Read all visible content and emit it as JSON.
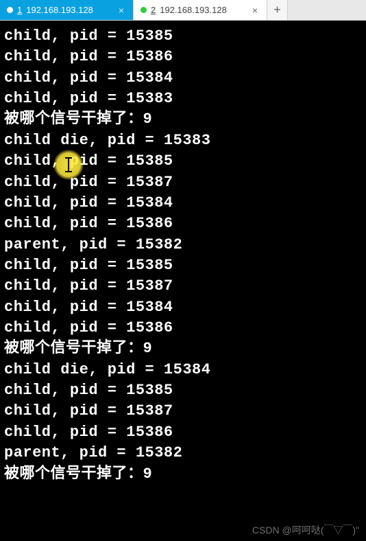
{
  "tabs": {
    "tab1": {
      "num": "1",
      "label": "192.168.193.128",
      "close": "×"
    },
    "tab2": {
      "num": "2",
      "label": "192.168.193.128",
      "close": "×"
    },
    "add": "+"
  },
  "terminal": {
    "lines": [
      "child, pid = 15385",
      "child, pid = 15386",
      "child, pid = 15384",
      "child, pid = 15383",
      "被哪个信号干掉了：9",
      "child die, pid = 15383",
      "child, pid = 15385",
      "child, pid = 15387",
      "child, pid = 15384",
      "child, pid = 15386",
      "parent, pid = 15382",
      "child, pid = 15385",
      "child, pid = 15387",
      "child, pid = 15384",
      "child, pid = 15386",
      "被哪个信号干掉了：9",
      "child die, pid = 15384",
      "child, pid = 15385",
      "child, pid = 15387",
      "child, pid = 15386",
      "parent, pid = 15382",
      "被哪个信号干掉了：9"
    ]
  },
  "watermark": "CSDN @呵呵哒(￣▽￣)\""
}
